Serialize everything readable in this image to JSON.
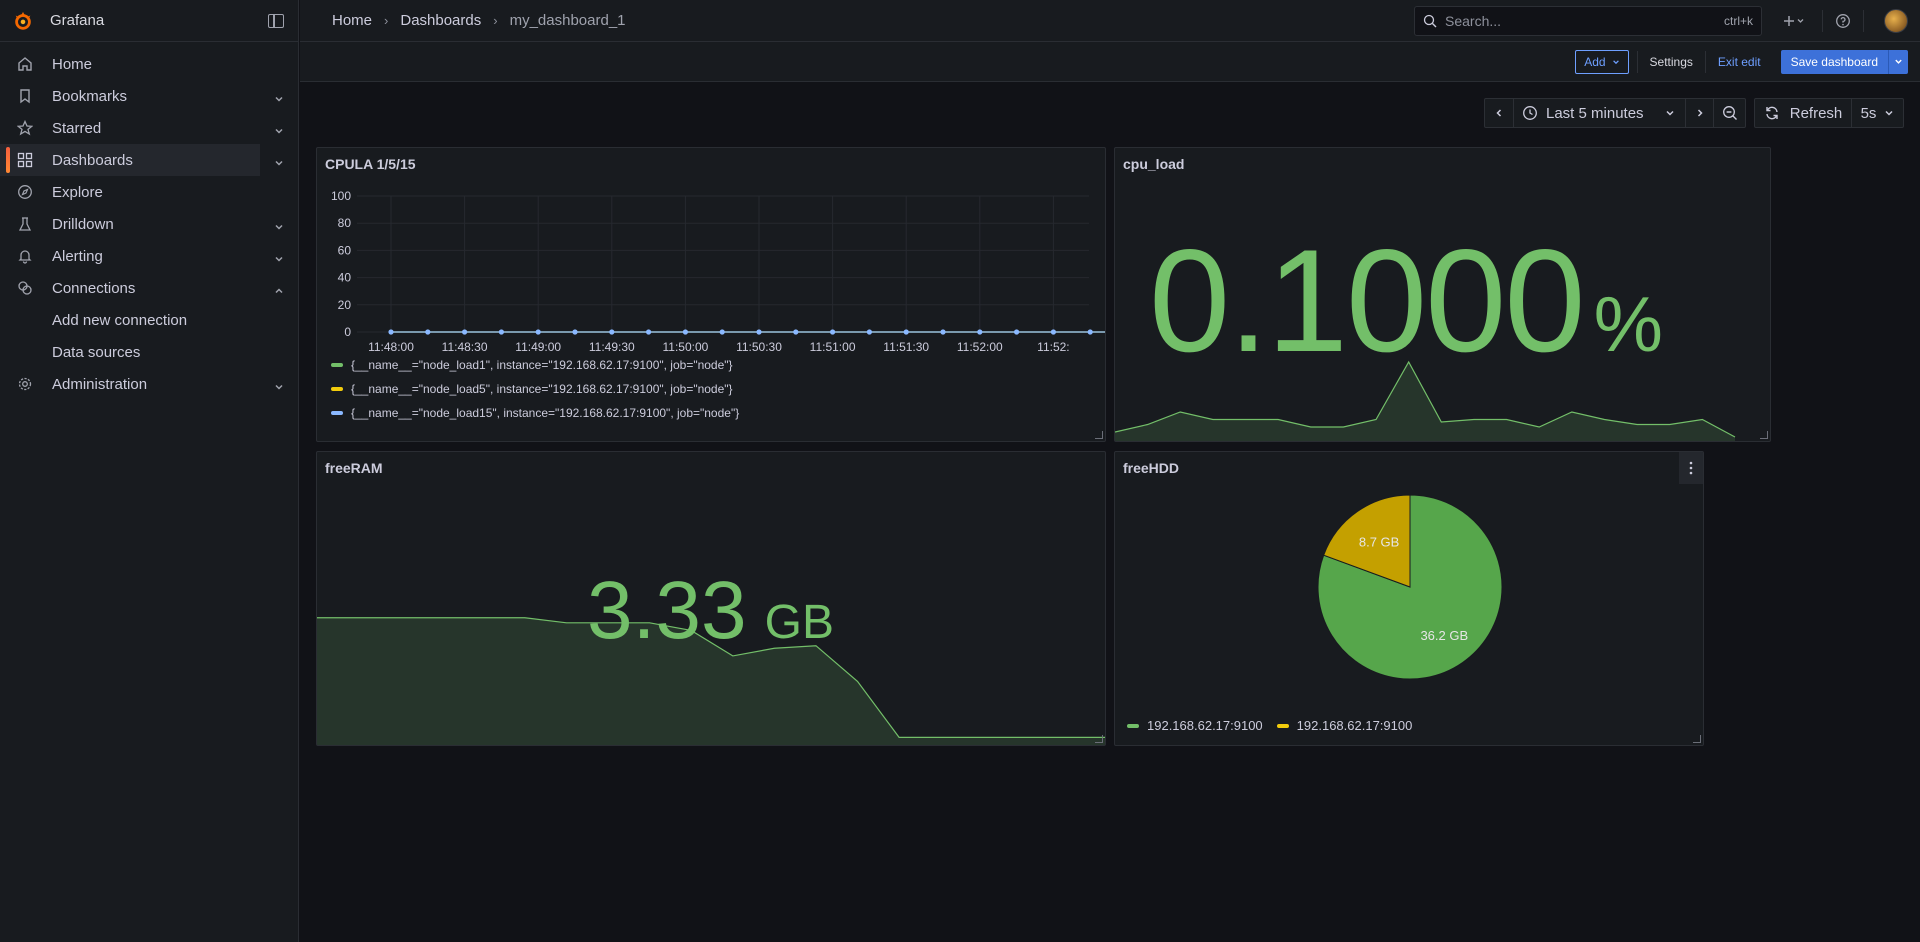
{
  "app": {
    "name": "Grafana"
  },
  "sidebar": {
    "items": [
      {
        "label": "Home",
        "icon": "home-icon"
      },
      {
        "label": "Bookmarks",
        "icon": "bookmark-icon"
      },
      {
        "label": "Starred",
        "icon": "star-icon"
      },
      {
        "label": "Dashboards",
        "icon": "dashboards-icon"
      },
      {
        "label": "Explore",
        "icon": "compass-icon"
      },
      {
        "label": "Drilldown",
        "icon": "drilldown-icon"
      },
      {
        "label": "Alerting",
        "icon": "bell-icon"
      },
      {
        "label": "Connections",
        "icon": "connections-icon"
      },
      {
        "label": "Administration",
        "icon": "gear-icon"
      }
    ],
    "sub_items": [
      "Add new connection",
      "Data sources"
    ]
  },
  "breadcrumb": [
    "Home",
    "Dashboards",
    "my_dashboard_1"
  ],
  "search": {
    "placeholder": "Search...",
    "shortcut": "ctrl+k"
  },
  "toolbar": {
    "add_label": "Add",
    "settings_label": "Settings",
    "exit_label": "Exit edit",
    "save_label": "Save dashboard"
  },
  "time": {
    "range_label": "Last 5 minutes",
    "refresh_label": "Refresh",
    "interval": "5s"
  },
  "colors": {
    "accent": "#3d71d9",
    "green": "#73bf69",
    "yellow": "#f2cc0c",
    "blue": "#8ab8ff",
    "orange": "#ff8833"
  },
  "panels": {
    "cpula": {
      "title": "CPULA 1/5/15",
      "legend": [
        "{__name__=\"node_load1\", instance=\"192.168.62.17:9100\", job=\"node\"}",
        "{__name__=\"node_load5\", instance=\"192.168.62.17:9100\", job=\"node\"}",
        "{__name__=\"node_load15\", instance=\"192.168.62.17:9100\", job=\"node\"}"
      ]
    },
    "cpu_load": {
      "title": "cpu_load",
      "value": "0.1000",
      "unit": "%"
    },
    "freeram": {
      "title": "freeRAM",
      "value": "3.33",
      "unit": "GB"
    },
    "freehdd": {
      "title": "freeHDD",
      "slice_labels": [
        "36.2 GB",
        "8.7 GB"
      ],
      "legend": [
        "192.168.62.17:9100",
        "192.168.62.17:9100"
      ]
    }
  },
  "chart_data": [
    {
      "type": "line",
      "title": "CPULA 1/5/15",
      "x": [
        "11:48:00",
        "11:48:30",
        "11:49:00",
        "11:49:30",
        "11:50:00",
        "11:50:30",
        "11:51:00",
        "11:51:30",
        "11:52:00",
        "11:52:"
      ],
      "yticks": [
        0,
        20,
        40,
        60,
        80,
        100
      ],
      "ylim": [
        0,
        100
      ],
      "grid": true,
      "legend_position": "bottom",
      "series": [
        {
          "name": "{__name__=\"node_load1\", instance=\"192.168.62.17:9100\", job=\"node\"}",
          "values": [
            0,
            0,
            0,
            0,
            0,
            0,
            0,
            0,
            0,
            0,
            0,
            0,
            0,
            0,
            0,
            0,
            0,
            0,
            0,
            0,
            0
          ]
        },
        {
          "name": "{__name__=\"node_load5\", instance=\"192.168.62.17:9100\", job=\"node\"}",
          "values": [
            0,
            0,
            0,
            0,
            0,
            0,
            0,
            0,
            0,
            0,
            0,
            0,
            0,
            0,
            0,
            0,
            0,
            0,
            0,
            0,
            0
          ]
        },
        {
          "name": "{__name__=\"node_load15\", instance=\"192.168.62.17:9100\", job=\"node\"}",
          "values": [
            0,
            0,
            0,
            0,
            0,
            0,
            0,
            0,
            0,
            0,
            0,
            0,
            0,
            0,
            0,
            0,
            0,
            0,
            0,
            0,
            0
          ]
        }
      ]
    },
    {
      "type": "area",
      "title": "cpu_load",
      "values": [
        0.02,
        0.05,
        0.1,
        0.07,
        0.07,
        0.07,
        0.04,
        0.04,
        0.07,
        0.3,
        0.06,
        0.07,
        0.07,
        0.04,
        0.1,
        0.07,
        0.05,
        0.05,
        0.07,
        0.0
      ]
    },
    {
      "type": "area",
      "title": "freeRAM",
      "values": [
        3.7,
        3.7,
        3.7,
        3.7,
        3.7,
        3.7,
        3.68,
        3.68,
        3.68,
        3.65,
        3.55,
        3.58,
        3.59,
        3.45,
        3.23,
        3.23,
        3.23,
        3.23,
        3.23,
        3.23
      ]
    },
    {
      "type": "pie",
      "title": "freeHDD",
      "categories": [
        "192.168.62.17:9100",
        "192.168.62.17:9100"
      ],
      "values": [
        36.2,
        8.7
      ]
    }
  ]
}
